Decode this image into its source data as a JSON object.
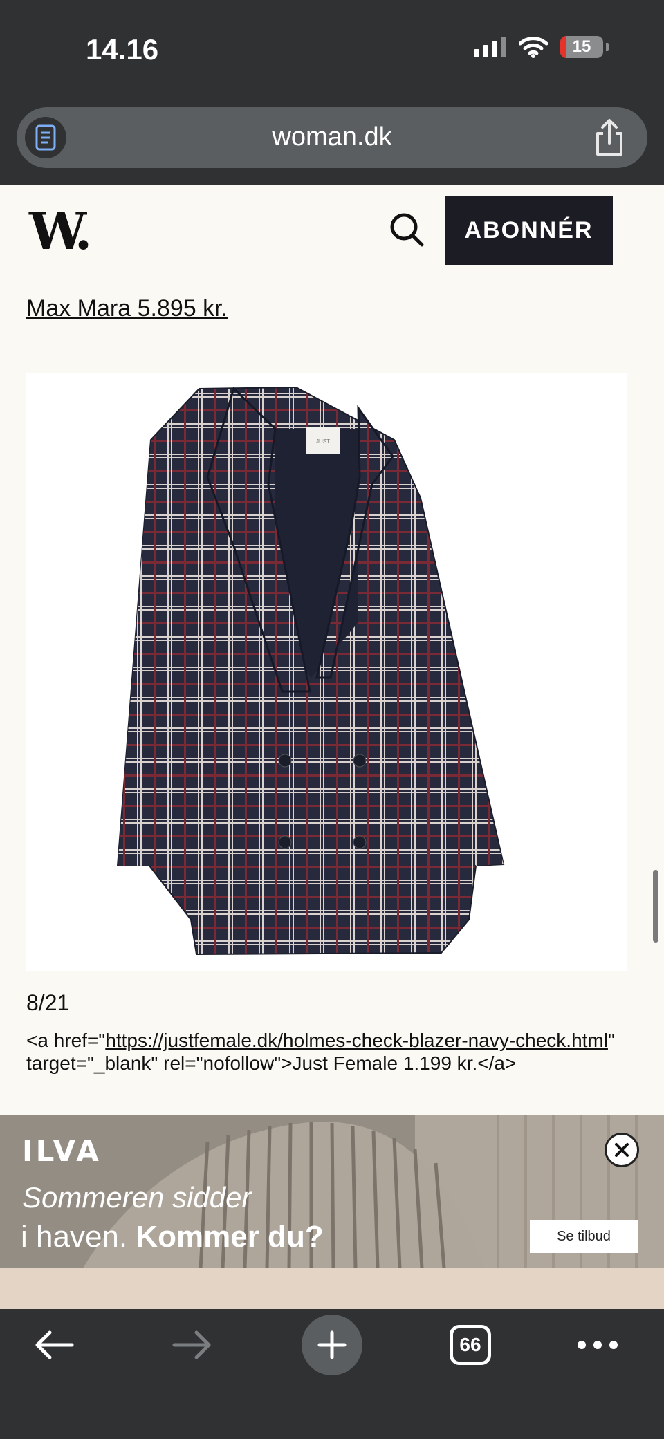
{
  "status_bar": {
    "time": "14.16",
    "battery_level": "15",
    "battery_color": "#e5322b",
    "signal_icon": "cellular-signal-icon",
    "wifi_icon": "wifi-icon"
  },
  "browser": {
    "url": "woman.dk",
    "reader_icon": "reader-mode-icon",
    "share_icon": "share-icon",
    "tab_count": "66"
  },
  "site": {
    "logo": "W.",
    "subscribe_label": "ABONNÉR",
    "search_icon": "search-icon"
  },
  "article": {
    "prev_link_text": "Max Mara 5.895 kr.",
    "image_label": "JUST",
    "counter": "8/21",
    "raw_prefix": "<a href=\"",
    "raw_url": "https://justfemale.dk/holmes-check-blazer-navy-check.html",
    "raw_suffix": "\" target=\"_blank\" rel=\"nofollow\">Just Female 1.199 kr.</a>"
  },
  "ad": {
    "brand": "ILVA",
    "line1": "Sommeren sidder",
    "line2_plain": "i haven. ",
    "line2_bold": "Kommer du?",
    "cta": "Se tilbud"
  },
  "colors": {
    "chrome": "#2f3133",
    "page_bg": "#fbf9f4",
    "button_dark": "#1b1c24",
    "blazer_navy": "#262a3c",
    "plaid_red": "#7a2a34",
    "plaid_white": "#d9d2cf"
  }
}
